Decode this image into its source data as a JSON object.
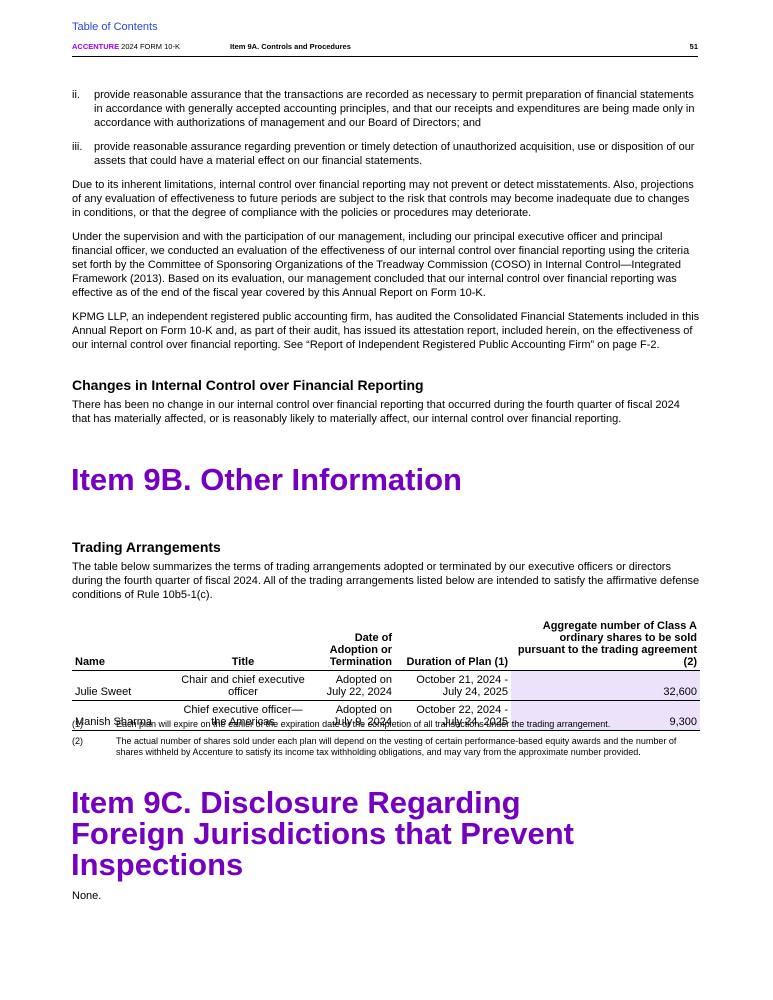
{
  "header": {
    "toc_link": "Table of Contents",
    "company": "ACCENTURE",
    "form": " 2024 FORM 10-K",
    "section": "Item 9A. Controls and Procedures",
    "page_number": "51"
  },
  "list_items": [
    {
      "marker": "ii.",
      "text": "provide reasonable assurance that the transactions are recorded as necessary to permit preparation of financial statements in accordance with generally accepted accounting principles, and that our receipts and expenditures are being made only in accordance with authorizations of management and our Board of Directors; and"
    },
    {
      "marker": "iii.",
      "text": "provide reasonable assurance regarding prevention or timely detection of unauthorized acquisition, use or disposition of our assets that could have a material effect on our financial statements."
    }
  ],
  "paragraphs": [
    "Due to its inherent limitations, internal control over financial reporting may not prevent or detect misstatements. Also, projections of any evaluation of effectiveness to future periods are subject to the risk that controls may become inadequate due to changes in conditions, or that the degree of compliance with the policies or procedures may deteriorate.",
    "Under the supervision and with the participation of our management, including our principal executive officer and principal financial officer, we conducted an evaluation of the effectiveness of our internal control over financial reporting using the criteria set forth by the Committee of Sponsoring Organizations of the Treadway Commission (COSO) in Internal Control—Integrated Framework (2013). Based on its evaluation, our management concluded that our internal control over financial reporting was effective as of the end of the fiscal year covered by this Annual Report on Form 10-K.",
    "KPMG LLP, an independent registered public accounting firm, has audited the Consolidated Financial Statements included in this Annual Report on Form 10-K and, as part of their audit, has issued its attestation report, included herein, on the effectiveness of our internal control over financial reporting. See “Report of Independent Registered Public Accounting Firm” on page F-2."
  ],
  "changes": {
    "heading": "Changes in Internal Control over Financial Reporting",
    "text": "There has been no change in our internal control over financial reporting that occurred during the fourth quarter of fiscal 2024 that has materially affected, or is reasonably likely to materially affect, our internal control over financial reporting."
  },
  "item9b": {
    "title": "Item 9B. Other Information",
    "subheading": "Trading Arrangements",
    "intro": "The table below summarizes the terms of trading arrangements adopted or terminated by our executive officers or directors during the fourth quarter of fiscal 2024. All of the trading arrangements listed below are intended to satisfy the affirmative defense conditions of Rule 10b5-1(c)."
  },
  "table": {
    "headers": {
      "name": "Name",
      "title": "Title",
      "date": "Date of Adoption or Termination",
      "duration": "Duration of Plan (1)",
      "aggregate": "Aggregate number of Class A ordinary shares to be sold pursuant to the trading agreement (2)"
    },
    "rows": [
      {
        "name": "Julie Sweet",
        "title": "Chair and chief executive officer",
        "date": "Adopted on July 22, 2024",
        "duration": "October 21, 2024 - July 24, 2025",
        "aggregate": "32,600"
      },
      {
        "name": "Manish Sharma",
        "title": "Chief executive officer—the Americas",
        "date": "Adopted on July 9, 2024",
        "duration": "October 22, 2024 - July 24, 2025",
        "aggregate": "9,300"
      }
    ]
  },
  "footnotes": [
    {
      "mark": "(1)",
      "text": "Each plan will expire on the earlier of the expiration date or the completion of all transactions under the trading arrangement."
    },
    {
      "mark": "(2)",
      "text": "The actual number of shares sold under each plan will depend on the vesting of certain performance-based equity awards and the number of shares withheld by Accenture to satisfy its income tax withholding obligations, and may vary from the approximate number provided."
    }
  ],
  "item9c": {
    "title": "Item 9C. Disclosure Regarding Foreign Jurisdictions that Prevent Inspections",
    "body": "None."
  }
}
